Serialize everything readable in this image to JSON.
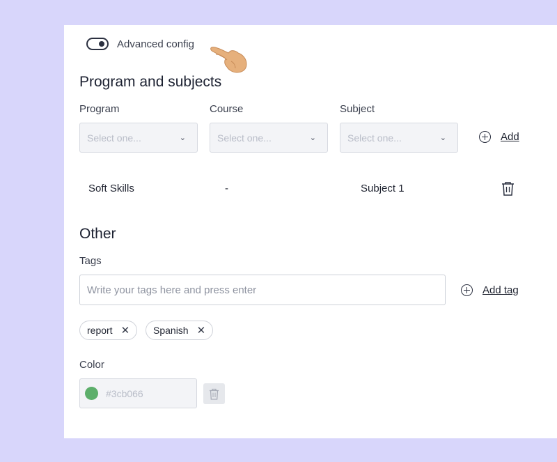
{
  "advanced": {
    "label": "Advanced config",
    "enabled": true
  },
  "program_section": {
    "title": "Program and subjects",
    "fields": [
      {
        "label": "Program",
        "placeholder": "Select one..."
      },
      {
        "label": "Course",
        "placeholder": "Select one..."
      },
      {
        "label": "Subject",
        "placeholder": "Select one..."
      }
    ],
    "add_label": "Add",
    "rows": [
      {
        "program": "Soft Skills",
        "course": "-",
        "subject": "Subject 1"
      }
    ]
  },
  "other_section": {
    "title": "Other",
    "tags_label": "Tags",
    "tags_placeholder": "Write your tags here and press enter",
    "add_tag_label": "Add tag",
    "tags": [
      "report",
      "Spanish"
    ],
    "color_label": "Color",
    "color_value": "#3cb066"
  },
  "colors": {
    "background": "#d8d6fb",
    "accent_swatch": "#5daf6b"
  },
  "icons": {
    "add": "plus-circle-icon",
    "delete": "trash-icon",
    "remove_tag": "close-icon",
    "dropdown": "chevron-down-icon",
    "pointer": "pointing-hand-icon"
  }
}
